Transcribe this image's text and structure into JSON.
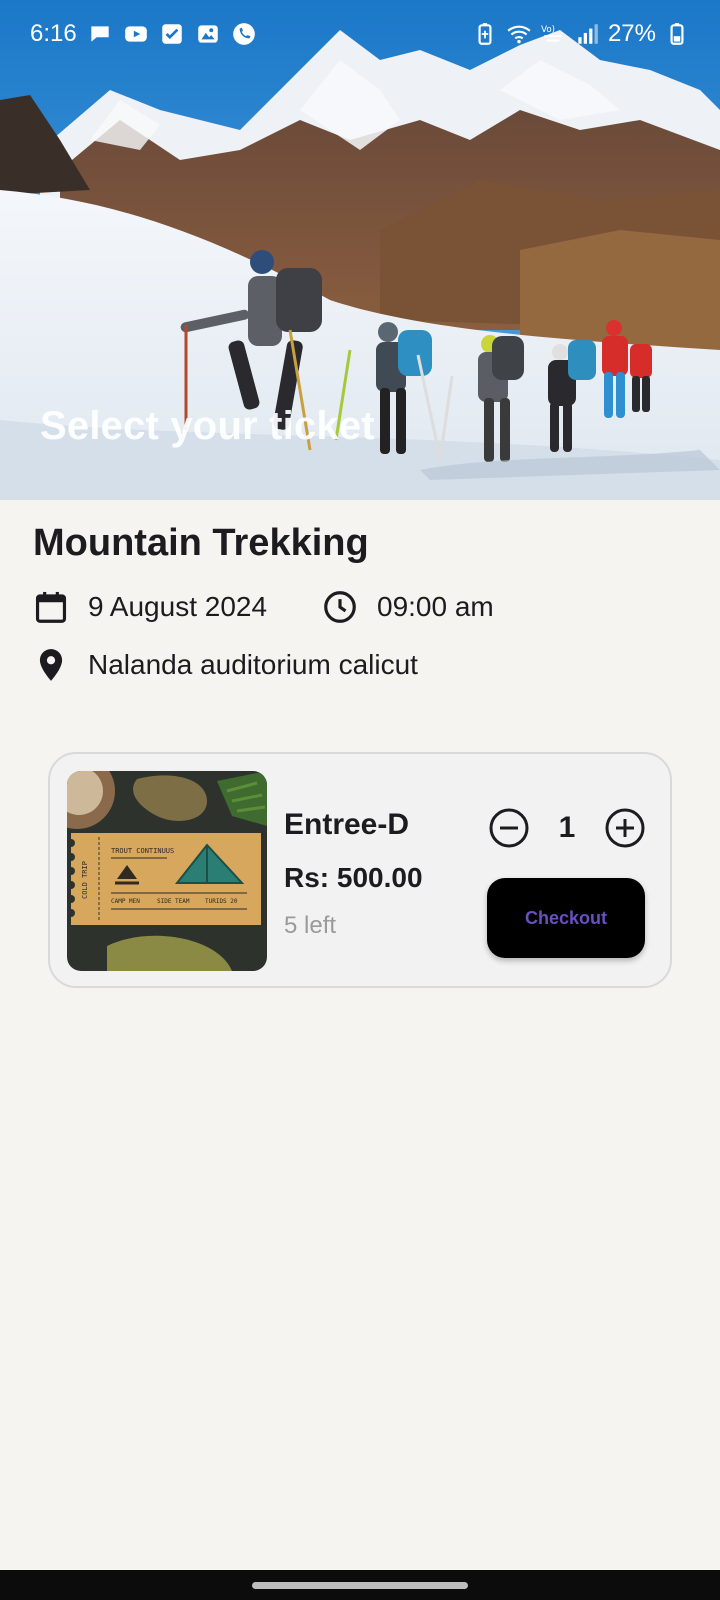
{
  "status_bar": {
    "time": "6:16",
    "battery": "27%",
    "left_icons": [
      "chat-icon",
      "youtube-icon",
      "check-box-icon",
      "gallery-icon",
      "phone-icon"
    ],
    "right_icons": [
      "battery-saver-icon",
      "wifi-icon",
      "volte-icon",
      "signal-icon",
      "battery-icon"
    ]
  },
  "hero": {
    "caption": "Select your ticket"
  },
  "event": {
    "title": "Mountain Trekking",
    "date": "9 August 2024",
    "time": "09:00 am",
    "venue": "Nalanda auditorium calicut"
  },
  "ticket": {
    "name": "Entree-D",
    "price": "Rs: 500.00",
    "remaining": "5 left",
    "quantity": "1",
    "checkout_label": "Checkout",
    "thumb_text": {
      "heading": "TROUT CONTINUUS",
      "side": "COLD TRIP",
      "row1": "CAMP MEN",
      "row2": "SIDE TEAM",
      "row3": "TURIDS 20"
    }
  },
  "colors": {
    "background": "#f5f4f1",
    "card_background": "#f2f2f3",
    "checkout_background": "#000000",
    "checkout_text": "#6a4fbf",
    "muted_text": "#9a9a9a"
  }
}
